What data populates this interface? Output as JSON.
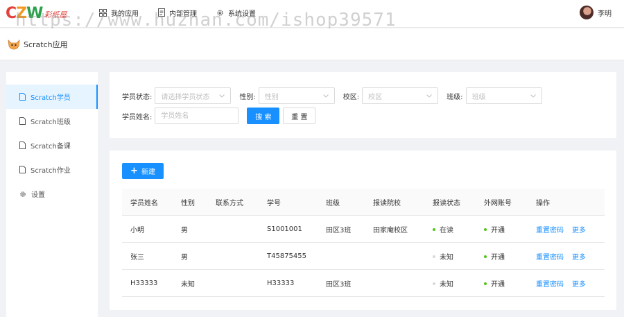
{
  "header": {
    "logo": {
      "letters": [
        "C",
        "Z",
        "W"
      ],
      "subtitle": "彩纸屋"
    },
    "nav": [
      {
        "label": "我的应用",
        "icon": "grid-icon"
      },
      {
        "label": "内部管理",
        "icon": "document-icon"
      },
      {
        "label": "系统设置",
        "icon": "gear-icon"
      }
    ],
    "user": {
      "name": "李明"
    },
    "watermark": "https://www.huzhan.com/ishop39571"
  },
  "breadcrumb": {
    "title": "Scratch应用"
  },
  "sidebar": {
    "items": [
      {
        "label": "Scratch学员",
        "icon": "file-icon",
        "active": true
      },
      {
        "label": "Scratch班级",
        "icon": "file-icon",
        "active": false
      },
      {
        "label": "Scratch备课",
        "icon": "file-icon",
        "active": false
      },
      {
        "label": "Scratch作业",
        "icon": "file-icon",
        "active": false
      },
      {
        "label": "设置",
        "icon": "gear-icon",
        "active": false
      }
    ]
  },
  "filters": {
    "status": {
      "label": "学员状态:",
      "placeholder": "请选择学员状态"
    },
    "gender": {
      "label": "性别:",
      "placeholder": "性别"
    },
    "campus": {
      "label": "校区:",
      "placeholder": "校区"
    },
    "class": {
      "label": "班级:",
      "placeholder": "班级"
    },
    "name": {
      "label": "学员姓名:",
      "placeholder": "学员姓名"
    },
    "search_label": "搜 索",
    "reset_label": "重 置"
  },
  "table": {
    "new_label": "新建",
    "columns": [
      "学员姓名",
      "性别",
      "联系方式",
      "学号",
      "班级",
      "报读院校",
      "报读状态",
      "外网账号",
      "操作"
    ],
    "rows": [
      {
        "name": "小明",
        "gender": "男",
        "contact": "",
        "student_no": "S1001001",
        "class": "田区3班",
        "school": "田家庵校区",
        "status": "在读",
        "status_color": "#52c41a",
        "account": "开通",
        "account_color": "#52c41a",
        "action_reset": "重置密码",
        "action_more": "更多"
      },
      {
        "name": "张三",
        "gender": "男",
        "contact": "",
        "student_no": "T45875455",
        "class": "",
        "school": "",
        "status": "未知",
        "status_color": "#d9d9d9",
        "account": "开通",
        "account_color": "#52c41a",
        "action_reset": "重置密码",
        "action_more": "更多"
      },
      {
        "name": "H33333",
        "gender": "未知",
        "contact": "",
        "student_no": "H33333",
        "class": "田区3班",
        "school": "",
        "status": "未知",
        "status_color": "#d9d9d9",
        "account": "开通",
        "account_color": "#52c41a",
        "action_reset": "重置密码",
        "action_more": "更多"
      }
    ]
  },
  "colors": {
    "primary": "#1890ff",
    "success": "#52c41a",
    "muted": "#d9d9d9"
  }
}
